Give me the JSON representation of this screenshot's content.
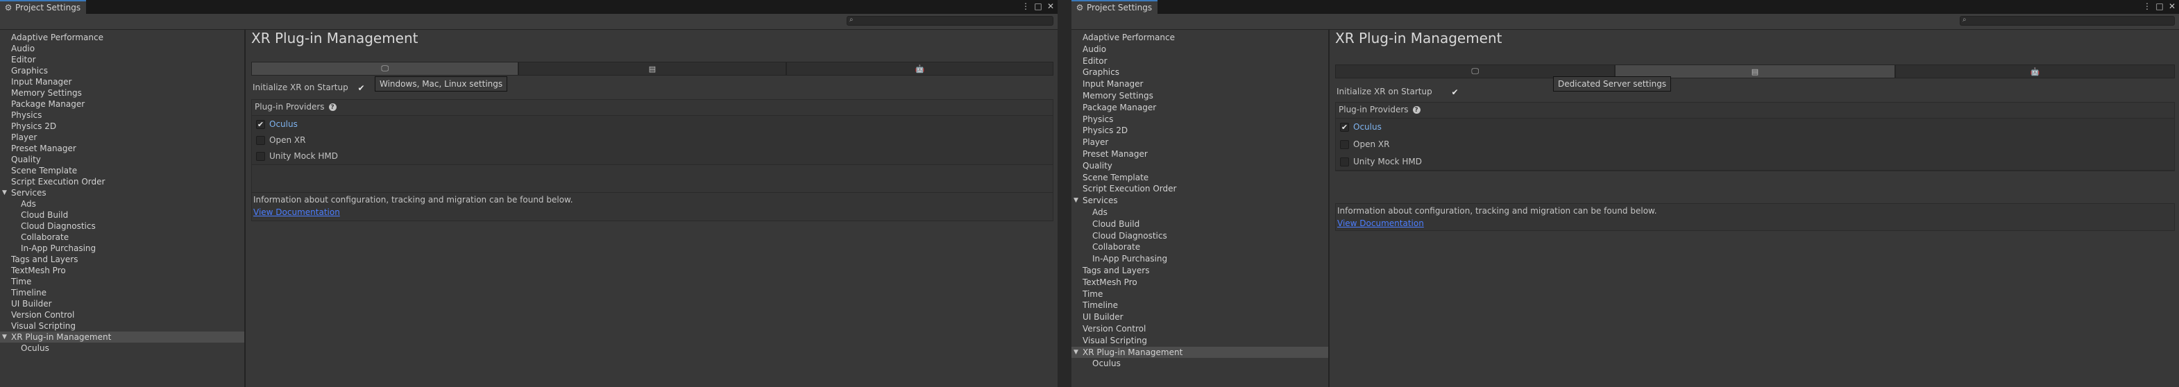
{
  "windows": [
    {
      "tab_title": "Project Settings",
      "search": {
        "placeholder": "",
        "value": ""
      },
      "nav": [
        {
          "label": "Adaptive Performance"
        },
        {
          "label": "Audio"
        },
        {
          "label": "Editor"
        },
        {
          "label": "Graphics"
        },
        {
          "label": "Input Manager"
        },
        {
          "label": "Memory Settings"
        },
        {
          "label": "Package Manager"
        },
        {
          "label": "Physics"
        },
        {
          "label": "Physics 2D"
        },
        {
          "label": "Player"
        },
        {
          "label": "Preset Manager"
        },
        {
          "label": "Quality"
        },
        {
          "label": "Scene Template"
        },
        {
          "label": "Script Execution Order"
        },
        {
          "label": "Services",
          "expanded": true
        },
        {
          "label": "Ads",
          "child": true
        },
        {
          "label": "Cloud Build",
          "child": true
        },
        {
          "label": "Cloud Diagnostics",
          "child": true
        },
        {
          "label": "Collaborate",
          "child": true
        },
        {
          "label": "In-App Purchasing",
          "child": true
        },
        {
          "label": "Tags and Layers"
        },
        {
          "label": "TextMesh Pro"
        },
        {
          "label": "Time"
        },
        {
          "label": "Timeline"
        },
        {
          "label": "UI Builder"
        },
        {
          "label": "Version Control"
        },
        {
          "label": "Visual Scripting"
        },
        {
          "label": "XR Plug-in Management",
          "expanded": true,
          "selected": true
        },
        {
          "label": "Oculus",
          "child": true
        }
      ],
      "content": {
        "title": "XR Plug-in Management",
        "platform_tabs": [
          {
            "icon": "desktop-icon",
            "active": true
          },
          {
            "icon": "server-icon",
            "active": false
          },
          {
            "icon": "android-icon",
            "active": false
          }
        ],
        "tooltip": "Windows, Mac, Linux settings",
        "init_label": "Initialize XR on Startup",
        "init_checked": true,
        "providers_label": "Plug-in Providers",
        "providers": [
          {
            "name": "Oculus",
            "checked": true
          },
          {
            "name": "Open XR",
            "checked": false
          },
          {
            "name": "Unity Mock HMD",
            "checked": false
          }
        ],
        "info_text": "Information about configuration, tracking and migration can be found below.",
        "doc_link": "View Documentation"
      }
    },
    {
      "tab_title": "Project Settings",
      "search": {
        "placeholder": "",
        "value": ""
      },
      "nav": [
        {
          "label": "Adaptive Performance"
        },
        {
          "label": "Audio"
        },
        {
          "label": "Editor"
        },
        {
          "label": "Graphics"
        },
        {
          "label": "Input Manager"
        },
        {
          "label": "Memory Settings"
        },
        {
          "label": "Package Manager"
        },
        {
          "label": "Physics"
        },
        {
          "label": "Physics 2D"
        },
        {
          "label": "Player"
        },
        {
          "label": "Preset Manager"
        },
        {
          "label": "Quality"
        },
        {
          "label": "Scene Template"
        },
        {
          "label": "Script Execution Order"
        },
        {
          "label": "Services",
          "expanded": true
        },
        {
          "label": "Ads",
          "child": true
        },
        {
          "label": "Cloud Build",
          "child": true
        },
        {
          "label": "Cloud Diagnostics",
          "child": true
        },
        {
          "label": "Collaborate",
          "child": true
        },
        {
          "label": "In-App Purchasing",
          "child": true
        },
        {
          "label": "Tags and Layers"
        },
        {
          "label": "TextMesh Pro"
        },
        {
          "label": "Time"
        },
        {
          "label": "Timeline"
        },
        {
          "label": "UI Builder"
        },
        {
          "label": "Version Control"
        },
        {
          "label": "Visual Scripting"
        },
        {
          "label": "XR Plug-in Management",
          "expanded": true,
          "selected": true
        },
        {
          "label": "Oculus",
          "child": true
        }
      ],
      "content": {
        "title": "XR Plug-in Management",
        "platform_tabs": [
          {
            "icon": "desktop-icon",
            "active": false
          },
          {
            "icon": "server-icon",
            "active": true
          },
          {
            "icon": "android-icon",
            "active": false
          }
        ],
        "tooltip": "Dedicated Server settings",
        "init_label": "Initialize XR on Startup",
        "init_checked": true,
        "providers_label": "Plug-in Providers",
        "providers": [
          {
            "name": "Oculus",
            "checked": true
          },
          {
            "name": "Open XR",
            "checked": false
          },
          {
            "name": "Unity Mock HMD",
            "checked": false
          }
        ],
        "info_text": "Information about configuration, tracking and migration can be found below.",
        "doc_link": "View Documentation"
      }
    }
  ]
}
